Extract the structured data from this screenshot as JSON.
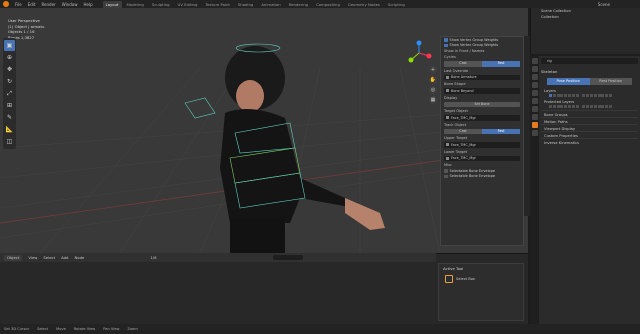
{
  "menu": [
    "File",
    "Edit",
    "Render",
    "Window",
    "Help"
  ],
  "workspace_tabs": [
    {
      "label": "Layout",
      "active": true
    },
    {
      "label": "Modeling",
      "active": false
    },
    {
      "label": "Sculpting",
      "active": false
    },
    {
      "label": "UV Editing",
      "active": false
    },
    {
      "label": "Texture Paint",
      "active": false
    },
    {
      "label": "Shading",
      "active": false
    },
    {
      "label": "Animation",
      "active": false
    },
    {
      "label": "Rendering",
      "active": false
    },
    {
      "label": "Compositing",
      "active": false
    },
    {
      "label": "Geometry Nodes",
      "active": false
    },
    {
      "label": "Scripting",
      "active": false
    }
  ],
  "scene_label": "Scene",
  "viewport": {
    "mode": "Object",
    "header_info": [
      "User Perspective",
      "(1) Object | armatu",
      "",
      "Objects   1 / 16",
      "Bones   1,3827"
    ],
    "menus": [
      "View",
      "Select",
      "Add",
      "Object"
    ],
    "toolbar_icons": [
      "select-box-icon",
      "cursor-icon",
      "move-icon",
      "rotate-icon",
      "scale-icon",
      "transform-icon",
      "annotate-icon",
      "measure-icon",
      "add-cube-icon"
    ]
  },
  "overlay": {
    "rows_top": [
      {
        "label": "Show Vertex Group Weights",
        "on": true
      },
      {
        "label": "Show Vertex Group Weights",
        "on": true
      }
    ],
    "section_vertex": "Show in Front / Names",
    "cycles": "Cycles",
    "seg1": [
      "Cast",
      "Fast"
    ],
    "last_override_label": "Last Override",
    "last_override_value": "Bone Armature",
    "bone_shape_label": "Bone Shape",
    "bone_shape_value": "Bone Beyond",
    "display_label": "Display",
    "display_button": "Set Bone",
    "target_label": "Target Object",
    "target_value": "Face_TMC_Mgr",
    "track_label": "Track Object",
    "seg2": [
      "Cast",
      "Fast"
    ],
    "upper_label": "Upper Target",
    "upper_value": "Face_TMC_Mgr",
    "lower_label": "Lower Target",
    "lower_value": "Face_TMC_Mgr",
    "section_misc": "Misc",
    "misc_rows": [
      "Selectable Bone Envelope",
      "Selectable Bone Envelope"
    ]
  },
  "timeline": {
    "mode": "Object",
    "menus": [
      "View",
      "Select",
      "Add",
      "Node"
    ],
    "search_placeholder": "",
    "frame": "1/6"
  },
  "redo_panel": {
    "title": "Active Tool",
    "entry": "Select Box"
  },
  "outliner": {
    "search_placeholder": "",
    "rows": [
      "Scene Collection",
      "Collection",
      "",
      ""
    ]
  },
  "properties": {
    "search_value": "rig",
    "section_skeleton": "Skeleton",
    "pose_seg": [
      "Pose Position",
      "Rest Position"
    ],
    "layers_label": "Layers",
    "protected_label": "Protected Layers",
    "collapsed": [
      "Bone Groups",
      "Motion Paths",
      "Viewport Display",
      "Custom Properties",
      "Inverse Kinematics"
    ]
  },
  "status": [
    "Set 3D Cursor",
    "Select",
    "Move",
    "Rotate View",
    "Pan View",
    "Zoom"
  ]
}
